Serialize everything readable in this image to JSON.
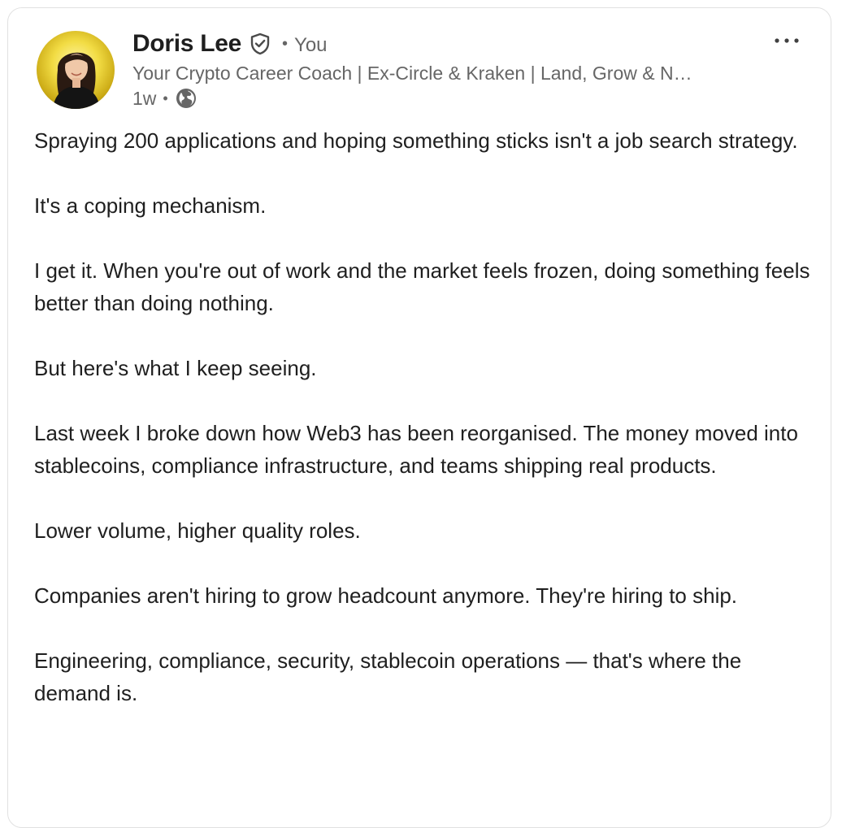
{
  "post": {
    "author": {
      "name": "Doris Lee",
      "relation": "You",
      "headline": "Your Crypto Career Coach | Ex-Circle & Kraken | Land, Grow & N…",
      "time": "1w",
      "visibility_icon": "globe-icon",
      "verified_icon": "shield-check-icon",
      "avatar_background": "#f2dc44"
    },
    "more_icon": "ellipsis-icon",
    "paragraphs": [
      "Spraying 200 applications and hoping something sticks isn't a job search strategy.",
      "It's a coping mechanism.",
      "I get it. When you're out of work and the market feels frozen, doing something feels better than doing nothing.",
      "But here's what I keep seeing.",
      "Last week I broke down how Web3 has been reorganised. The money moved into stablecoins, compliance infrastructure, and teams shipping real products.",
      "Lower volume, higher quality roles.",
      "Companies aren't hiring to grow headcount anymore. They're hiring to ship.",
      "Engineering, compliance, security, stablecoin operations — that's where the demand is."
    ]
  },
  "colors": {
    "text_primary": "#1f1f1f",
    "text_secondary": "#666666",
    "card_border": "#e1e1e1"
  }
}
